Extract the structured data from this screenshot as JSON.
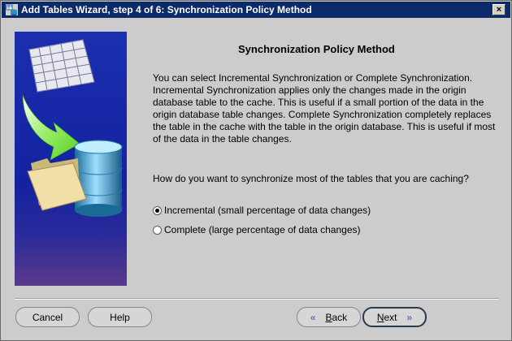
{
  "window": {
    "title": "Add Tables Wizard, step 4 of 6: Synchronization Policy Method",
    "close_label": "×"
  },
  "content": {
    "heading": "Synchronization Policy Method",
    "description": "You can select Incremental Synchronization or Complete Synchronization. Incremental Synchronization applies only the changes made in the origin database table to the cache. This is useful if a small portion of the data in the origin database table changes.  Complete Synchronization completely replaces the table in the cache with the table in the origin database.  This is useful if most of the data in the table changes.",
    "question": "How do you want to synchronize most of the tables that you are caching?",
    "options": [
      {
        "label": "Incremental (small percentage of data changes)",
        "selected": true
      },
      {
        "label": "Complete (large percentage of data changes)",
        "selected": false
      }
    ]
  },
  "buttons": {
    "cancel": "Cancel",
    "help": "Help",
    "back_mnemonic": "B",
    "back_rest": "ack",
    "next_mnemonic": "N",
    "next_rest": "ext",
    "back_icon": "chevron-left-icon",
    "next_icon": "chevron-right-icon"
  },
  "colors": {
    "titlebar": "#0a2a6a",
    "dialog_bg": "#cccccc",
    "banner_bg": "#10209a",
    "arrow": "#66dd33",
    "folder": "#e8d7a0",
    "database": "#2a8ab8"
  }
}
